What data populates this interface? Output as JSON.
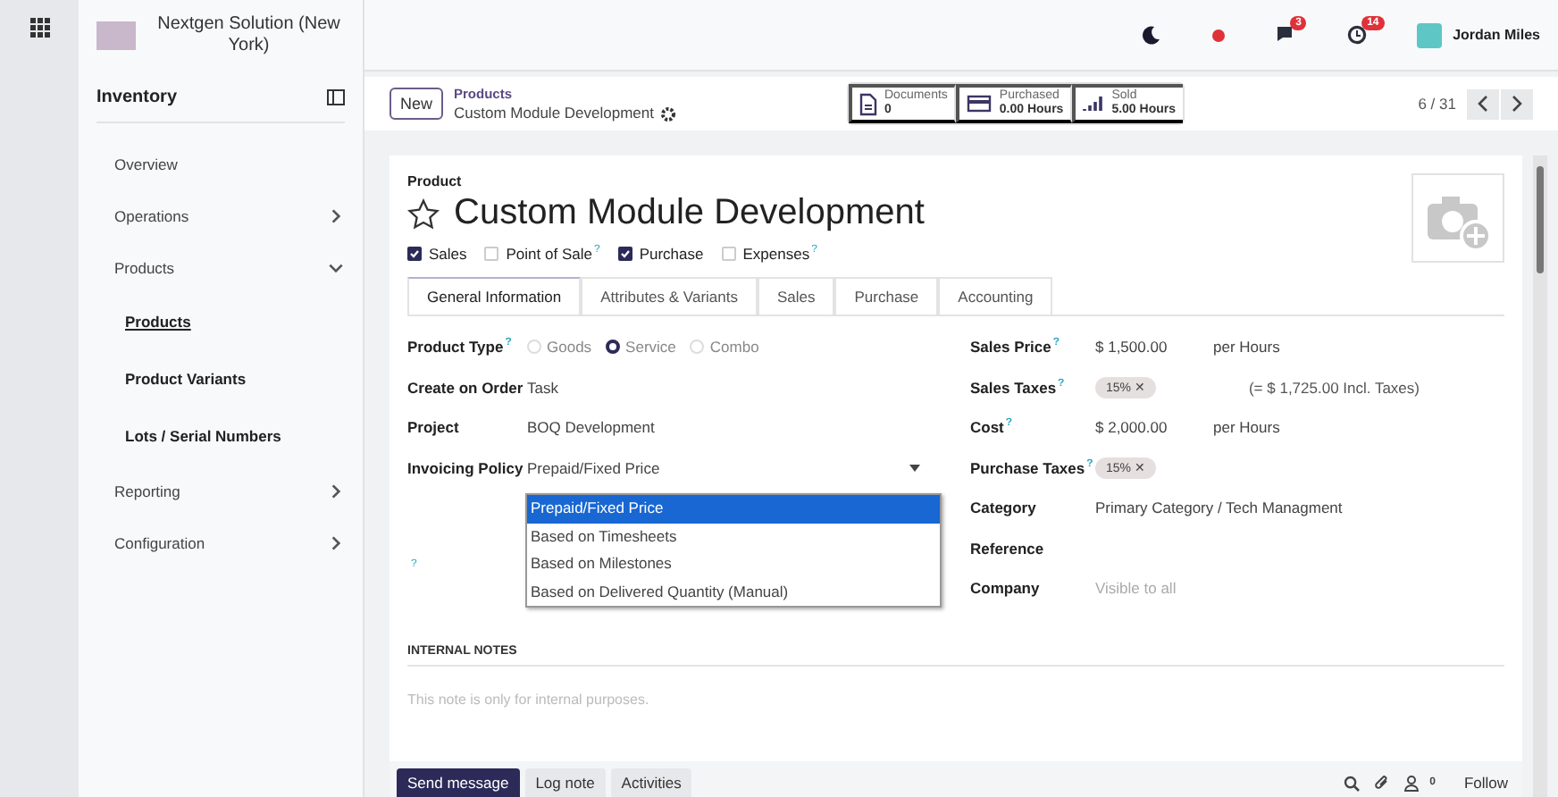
{
  "topbar": {
    "company": "Nextgen Solution (New York)",
    "chat_badge": "3",
    "activity_badge": "14",
    "user": "Jordan Miles"
  },
  "sidebar": {
    "title": "Inventory",
    "items": [
      {
        "label": "Overview"
      },
      {
        "label": "Operations",
        "expanded": false
      },
      {
        "label": "Products",
        "expanded": true,
        "children": [
          {
            "label": "Products",
            "selected": true
          },
          {
            "label": "Product Variants",
            "selected": false
          },
          {
            "label": "Lots / Serial Numbers",
            "selected": false
          }
        ]
      },
      {
        "label": "Reporting",
        "expanded": false
      },
      {
        "label": "Configuration",
        "expanded": false
      }
    ]
  },
  "control": {
    "new_button": "New",
    "breadcrumb": "Products",
    "record": "Custom Module Development",
    "stats": [
      {
        "kind": "documents",
        "label": "Documents",
        "value": "0"
      },
      {
        "kind": "card",
        "label": "Purchased",
        "value": "0.00 Hours"
      },
      {
        "kind": "bars",
        "label": "Sold",
        "value": "5.00 Hours"
      }
    ],
    "pager": "6 / 31"
  },
  "form": {
    "caption": "Product",
    "name": "Custom Module Development",
    "favorite": false,
    "flags": [
      {
        "label": "Sales",
        "checked": true
      },
      {
        "label": "Point of Sale",
        "checked": false,
        "help": "?"
      },
      {
        "label": "Purchase",
        "checked": true
      },
      {
        "label": "Expenses",
        "checked": false,
        "help": "?"
      }
    ],
    "tabs": [
      {
        "label": "General Information",
        "selected": true
      },
      {
        "label": "Attributes & Variants",
        "selected": false
      },
      {
        "label": "Sales",
        "selected": false
      },
      {
        "label": "Purchase",
        "selected": false
      },
      {
        "label": "Accounting",
        "selected": false
      }
    ],
    "left_fields": [
      {
        "kind": "radio",
        "label": "Product Type",
        "help": "?",
        "options": [
          {
            "label": "Goods",
            "selected": false
          },
          {
            "label": "Service",
            "selected": true
          },
          {
            "label": "Combo",
            "selected": false
          }
        ]
      },
      {
        "kind": "text",
        "label": "Create on Order",
        "value": "Task"
      },
      {
        "kind": "text",
        "label": "Project",
        "value": "BOQ Development"
      },
      {
        "kind": "select",
        "label": "Invoicing Policy",
        "value": "Prepaid/Fixed Price",
        "open": true,
        "options": [
          {
            "label": "Prepaid/Fixed Price",
            "selected": true
          },
          {
            "label": "Based on Timesheets",
            "selected": false
          },
          {
            "label": "Based on Milestones",
            "selected": false
          },
          {
            "label": "Based on Delivered Quantity (Manual)",
            "selected": false
          }
        ]
      }
    ],
    "orphan_help": "?",
    "right_fields": [
      {
        "kind": "amount",
        "label": "Sales Price",
        "help": "?",
        "value": "$ 1,500.00",
        "unit": "per Hours"
      },
      {
        "kind": "tag",
        "label": "Sales Taxes",
        "help": "?",
        "value": "15%",
        "remove": "✕",
        "note": "(= $ 1,725.00 Incl. Taxes)"
      },
      {
        "kind": "amount",
        "label": "Cost",
        "help": "?",
        "value": "$ 2,000.00",
        "unit": "per Hours"
      },
      {
        "kind": "tag",
        "label": "Purchase Taxes",
        "help": "?",
        "value": "15%",
        "remove": "✕"
      },
      {
        "kind": "text",
        "label": "Category",
        "value": "Primary Category / Tech Managment"
      },
      {
        "kind": "text",
        "label": "Reference"
      },
      {
        "kind": "muted",
        "label": "Company",
        "placeholder": "Visible to all"
      }
    ],
    "notes_title": "INTERNAL NOTES",
    "notes_placeholder": "This note is only for internal purposes."
  },
  "chatter": {
    "buttons": [
      {
        "label": "Send message",
        "selected": true
      },
      {
        "label": "Log note",
        "selected": false
      },
      {
        "label": "Activities",
        "selected": false
      }
    ],
    "followers": "0",
    "follow": "Follow"
  }
}
